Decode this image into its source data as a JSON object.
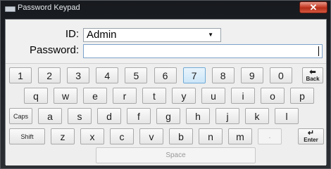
{
  "window": {
    "title": "Password Keypad",
    "close_symbol": "✕"
  },
  "form": {
    "id_label": "ID:",
    "id_value": "Admin",
    "password_label": "Password:",
    "password_value": ""
  },
  "keypad": {
    "row1": [
      "1",
      "2",
      "3",
      "4",
      "5",
      "6",
      "7",
      "8",
      "9",
      "0"
    ],
    "back_label": "Back",
    "row2": [
      "q",
      "w",
      "e",
      "r",
      "t",
      "y",
      "u",
      "i",
      "o",
      "p"
    ],
    "caps_label": "Caps",
    "row3": [
      "a",
      "s",
      "d",
      "f",
      "g",
      "h",
      "j",
      "k",
      "l"
    ],
    "shift_label": "Shift",
    "row4": [
      "z",
      "x",
      "c",
      "v",
      "b",
      "n",
      "m",
      "."
    ],
    "enter_label": "Enter",
    "space_label": "Space",
    "highlighted_key": "7"
  },
  "icons": {
    "window": "keypad-window-icon",
    "back": "back-arrow-icon",
    "enter": "enter-arrow-icon",
    "dropdown": "chevron-down-icon"
  }
}
